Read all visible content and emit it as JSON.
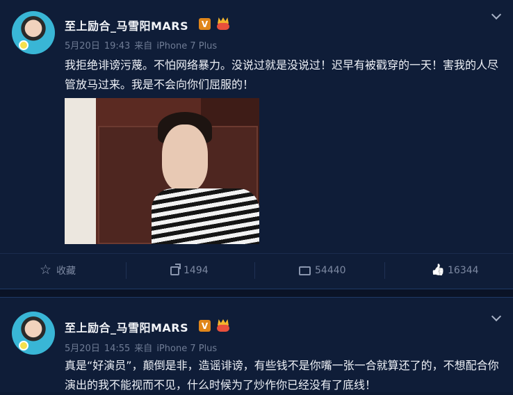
{
  "posts": [
    {
      "username": "至上励合_马雪阳MARS",
      "verified_badge": "V",
      "meta": {
        "date": "5月20日",
        "time": "19:43",
        "source_prefix": "来自",
        "source": "iPhone 7 Plus"
      },
      "text": "我拒绝诽谤污蔑。不怕网络暴力。没说过就是没说过！迟早有被戳穿的一天！害我的人尽管放马过来。我是不会向你们屈服的！",
      "actions": {
        "favorite": {
          "label": "收藏",
          "icon": "star-icon"
        },
        "repost": {
          "count": "1494",
          "icon": "share-icon"
        },
        "comment": {
          "count": "54440",
          "icon": "comment-icon"
        },
        "like": {
          "count": "16344",
          "icon": "like-icon"
        }
      }
    },
    {
      "username": "至上励合_马雪阳MARS",
      "verified_badge": "V",
      "meta": {
        "date": "5月20日",
        "time": "14:55",
        "source_prefix": "来自",
        "source": "iPhone 7 Plus"
      },
      "text": "真是“好演员”，颠倒是非，造谣诽谤，有些钱不是你嘴一张一合就算还了的，不想配合你演出的我不能视而不见，什么时候为了炒作你已经没有了底线！"
    }
  ],
  "colors": {
    "background": "#0f1d38",
    "verified": "#e0861a",
    "muted": "#6f7c95"
  }
}
